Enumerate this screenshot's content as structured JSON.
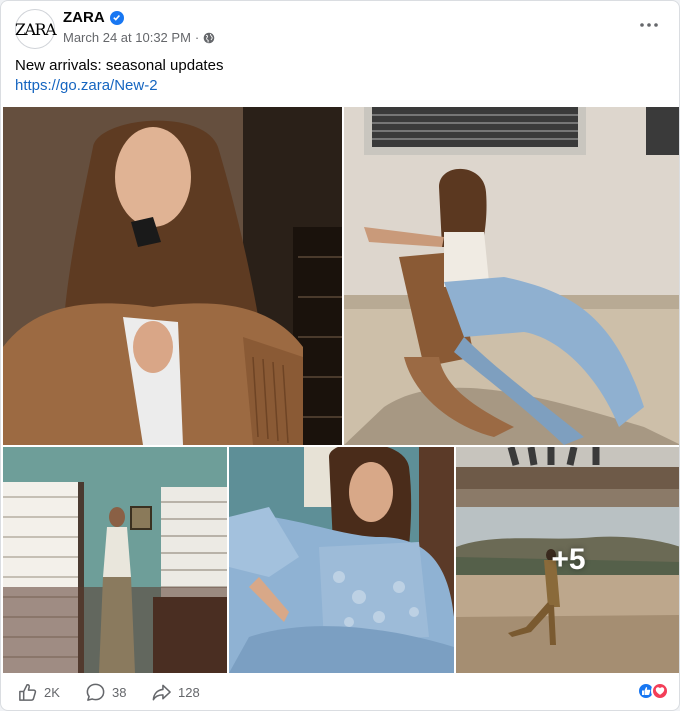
{
  "post": {
    "page_name": "ZARA",
    "avatar_text": "ZARA",
    "timestamp": "March 24 at 10:32 PM",
    "separator": "·",
    "caption": "New arrivals: seasonal updates",
    "link": "https://go.zara/New-2"
  },
  "gallery": {
    "photo_count": 5,
    "more_label": "+5",
    "photos": [
      {
        "label": "woman-in-suede-fringe-jacket-on-phone"
      },
      {
        "label": "woman-in-chair-wearing-jeans"
      },
      {
        "label": "woman-standing-by-window"
      },
      {
        "label": "woman-in-denim-sitting"
      },
      {
        "label": "motel-landscape"
      }
    ]
  },
  "stats": {
    "likes": "2K",
    "comments": "38",
    "shares": "128"
  },
  "colors": {
    "brand_blue": "#1877f2",
    "link_blue": "#1565c0",
    "love_red": "#f33e58",
    "muted_text": "#65676b"
  },
  "icons": {
    "verified": "verified-badge-icon",
    "privacy": "globe-icon",
    "more": "more-options-icon",
    "like": "thumbs-up-icon",
    "comment": "comment-bubble-icon",
    "share": "share-arrow-icon",
    "reaction_like": "like-reaction-icon",
    "reaction_love": "love-reaction-icon"
  }
}
